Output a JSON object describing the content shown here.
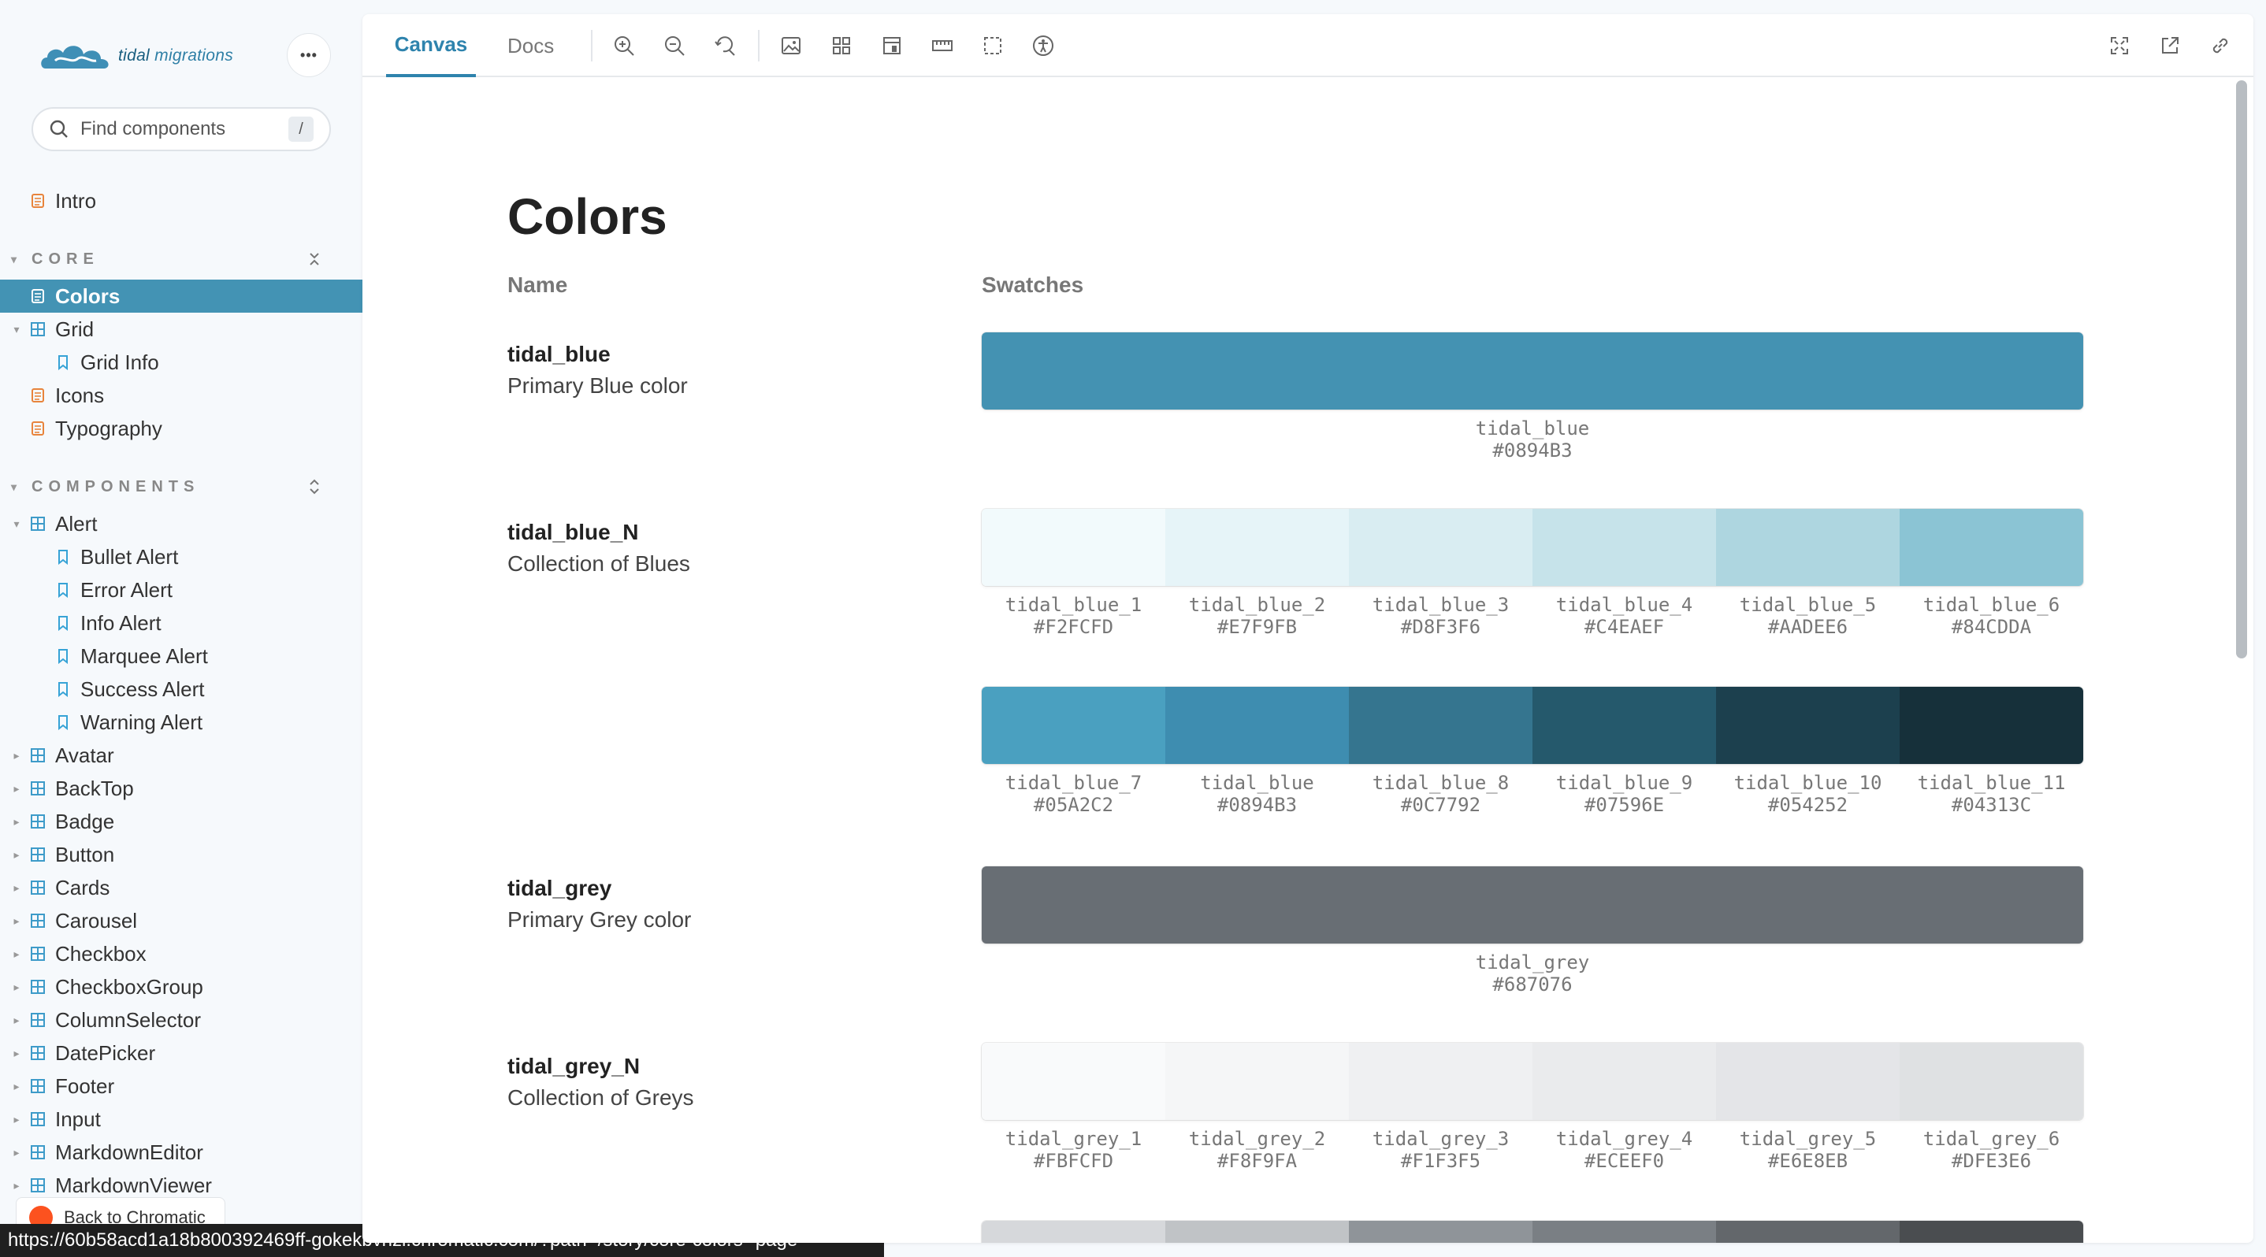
{
  "app": {
    "logo_prefix": "tidal",
    "logo_suffix": " migrations",
    "menu_label": "•••"
  },
  "search": {
    "placeholder": "Find components",
    "shortcut": "/"
  },
  "sidebar": {
    "intro": "Intro",
    "sections": [
      {
        "label": "CORE"
      },
      {
        "label": "COMPONENTS"
      }
    ],
    "core_items": [
      {
        "label": "Colors",
        "kind": "doc",
        "selected": true
      },
      {
        "label": "Grid",
        "kind": "component",
        "expanded": true
      },
      {
        "label": "Grid Info",
        "kind": "story"
      },
      {
        "label": "Icons",
        "kind": "doc"
      },
      {
        "label": "Typography",
        "kind": "doc"
      }
    ],
    "component_items": [
      {
        "label": "Alert",
        "kind": "component",
        "expanded": true
      },
      {
        "label": "Bullet Alert",
        "kind": "story"
      },
      {
        "label": "Error Alert",
        "kind": "story"
      },
      {
        "label": "Info Alert",
        "kind": "story"
      },
      {
        "label": "Marquee Alert",
        "kind": "story"
      },
      {
        "label": "Success Alert",
        "kind": "story"
      },
      {
        "label": "Warning Alert",
        "kind": "story"
      },
      {
        "label": "Avatar",
        "kind": "component"
      },
      {
        "label": "BackTop",
        "kind": "component"
      },
      {
        "label": "Badge",
        "kind": "component"
      },
      {
        "label": "Button",
        "kind": "component"
      },
      {
        "label": "Cards",
        "kind": "component"
      },
      {
        "label": "Carousel",
        "kind": "component"
      },
      {
        "label": "Checkbox",
        "kind": "component"
      },
      {
        "label": "CheckboxGroup",
        "kind": "component"
      },
      {
        "label": "ColumnSelector",
        "kind": "component"
      },
      {
        "label": "DatePicker",
        "kind": "component"
      },
      {
        "label": "Footer",
        "kind": "component"
      },
      {
        "label": "Input",
        "kind": "component"
      },
      {
        "label": "MarkdownEditor",
        "kind": "component"
      },
      {
        "label": "MarkdownViewer",
        "kind": "component"
      }
    ],
    "back_label": "Back to Chromatic"
  },
  "status_url": "https://60b58acd1a18b800392469ff-gokekbvnzl.chromatic.com/?path=/story/core-colors--page",
  "toolbar": {
    "tabs": [
      "Canvas",
      "Docs"
    ]
  },
  "page": {
    "title": "Colors",
    "col_name": "Name",
    "col_swatches": "Swatches",
    "groups": [
      {
        "name": "tidal_blue",
        "desc": "Primary Blue color",
        "swatches": [
          {
            "label": "tidal_blue",
            "hex": "#0894B3",
            "color": "#4492b2"
          }
        ]
      },
      {
        "name": "tidal_blue_N",
        "desc": "Collection of Blues",
        "swatches": [
          {
            "label": "tidal_blue_1",
            "hex": "#F2FCFD",
            "color": "#f2fafc"
          },
          {
            "label": "tidal_blue_2",
            "hex": "#E7F9FB",
            "color": "#e6f4f8"
          },
          {
            "label": "tidal_blue_3",
            "hex": "#D8F3F6",
            "color": "#d9edf2"
          },
          {
            "label": "tidal_blue_4",
            "hex": "#C4EAEF",
            "color": "#c6e3ea"
          },
          {
            "label": "tidal_blue_5",
            "hex": "#AADEE6",
            "color": "#aed6e0"
          },
          {
            "label": "tidal_blue_6",
            "hex": "#84CDDA",
            "color": "#8bc4d4"
          }
        ],
        "swatches2": [
          {
            "label": "tidal_blue_7",
            "hex": "#05A2C2",
            "color": "#4aa0c0"
          },
          {
            "label": "tidal_blue",
            "hex": "#0894B3",
            "color": "#3e8db0"
          },
          {
            "label": "tidal_blue_8",
            "hex": "#0C7792",
            "color": "#35758f"
          },
          {
            "label": "tidal_blue_9",
            "hex": "#07596E",
            "color": "#25596c"
          },
          {
            "label": "tidal_blue_10",
            "hex": "#054252",
            "color": "#1c404e"
          },
          {
            "label": "tidal_blue_11",
            "hex": "#04313C",
            "color": "#16303a"
          }
        ]
      },
      {
        "name": "tidal_grey",
        "desc": "Primary Grey color",
        "swatches": [
          {
            "label": "tidal_grey",
            "hex": "#687076",
            "color": "#686e74"
          }
        ]
      },
      {
        "name": "tidal_grey_N",
        "desc": "Collection of Greys",
        "swatches": [
          {
            "label": "tidal_grey_1",
            "hex": "#FBFCFD",
            "color": "#f9fafb"
          },
          {
            "label": "tidal_grey_2",
            "hex": "#F8F9FA",
            "color": "#f5f6f7"
          },
          {
            "label": "tidal_grey_3",
            "hex": "#F1F3F5",
            "color": "#eff0f2"
          },
          {
            "label": "tidal_grey_4",
            "hex": "#ECEEF0",
            "color": "#eaebed"
          },
          {
            "label": "tidal_grey_5",
            "hex": "#E6E8EB",
            "color": "#e4e5e8"
          },
          {
            "label": "tidal_grey_6",
            "hex": "#DFE3E6",
            "color": "#dfe1e3"
          }
        ],
        "swatches2_colors": [
          "#d6d8db",
          "#c0c3c6",
          "#8f9499",
          "#7a7f84",
          "#63676b",
          "#4a4d50"
        ]
      }
    ]
  },
  "colors": {
    "accent": "#2e83ad",
    "selected_bg": "#4393b4",
    "doc_icon": "#e8843c",
    "component_icon": "#3d9bc9",
    "story_icon": "#37a3d6"
  }
}
